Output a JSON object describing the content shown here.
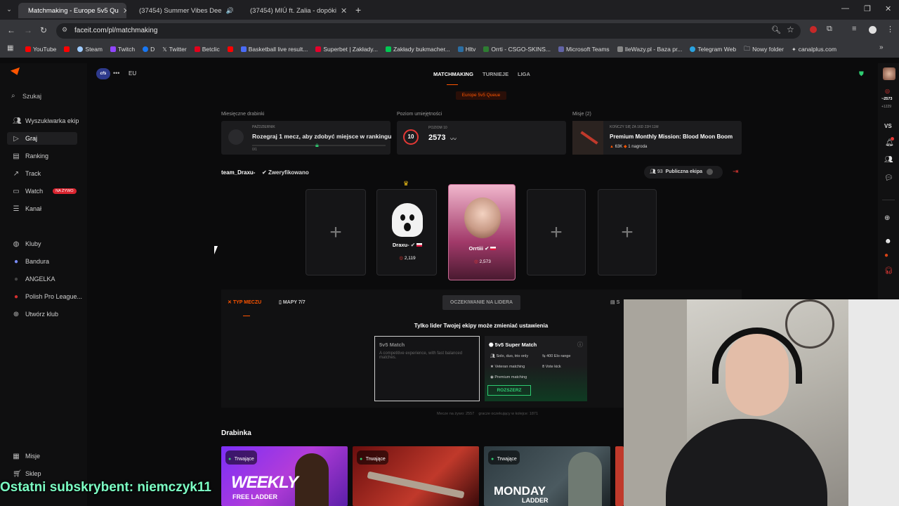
{
  "browser": {
    "tabs": [
      {
        "title": "Matchmaking - Europe 5v5 Qu",
        "favicon_color": "#ff5500",
        "active": true
      },
      {
        "title": "(37454) Summer Vibes Dee",
        "favicon_color": "#ff0000",
        "active": false
      },
      {
        "title": "(37454) MIÚ ft. Zalia - dopóki",
        "favicon_color": "#ff0000",
        "active": false
      }
    ],
    "new_tab": "+",
    "url": "faceit.com/pl/matchmaking",
    "bookmarks": [
      {
        "label": "YouTube",
        "color": "#ff0000"
      },
      {
        "label": "",
        "color": "#ff0000"
      },
      {
        "label": "Steam",
        "color": "#9ecbff"
      },
      {
        "label": "Twitch",
        "color": "#9146ff"
      },
      {
        "label": "D",
        "color": "#1877f2"
      },
      {
        "label": "Twitter",
        "color": "#ffffff"
      },
      {
        "label": "Betclic",
        "color": "#e3001b"
      },
      {
        "label": "",
        "color": "#ff0000"
      },
      {
        "label": "Basketball live result...",
        "color": "#4a6cf7"
      },
      {
        "label": "Superbet | Zakłady...",
        "color": "#e4002b"
      },
      {
        "label": "Zakłady bukmacher...",
        "color": "#00c853"
      },
      {
        "label": "Hltv",
        "color": "#2b6ea3"
      },
      {
        "label": "Orrti - CSGO-SKINS...",
        "color": "#2e7d32"
      },
      {
        "label": "Microsoft Teams",
        "color": "#6264a7"
      },
      {
        "label": "IleWazy.pl - Baza pr...",
        "color": "#888888"
      },
      {
        "label": "Telegram Web",
        "color": "#2aa3e0"
      },
      {
        "label": "Nowy folder",
        "color": "#cccccc"
      },
      {
        "label": "canalplus.com",
        "color": "#ffffff"
      }
    ]
  },
  "sidebar": {
    "search": "Szukaj",
    "items": [
      {
        "label": "Wyszukiwarka ekip",
        "icon": "users-icon"
      },
      {
        "label": "Graj",
        "icon": "play-icon"
      },
      {
        "label": "Ranking",
        "icon": "ranking-icon"
      },
      {
        "label": "Track",
        "icon": "track-icon"
      },
      {
        "label": "Watch",
        "icon": "watch-icon"
      },
      {
        "label": "Kanał",
        "icon": "feed-icon"
      }
    ],
    "watch_badge": "NA ŻYWO",
    "clubs": [
      {
        "label": "Kluby"
      },
      {
        "label": "Bandura"
      },
      {
        "label": "ANGELKA"
      },
      {
        "label": "Polish Pro League..."
      },
      {
        "label": "Utwórz klub"
      }
    ],
    "bottom": [
      "Misje",
      "Sklep"
    ]
  },
  "topnav": {
    "region": "EU",
    "links": [
      "MATCHMAKING",
      "TURNIEJE",
      "LIGA"
    ],
    "queue_badge": "Europe 5v5 Queue"
  },
  "stats": {
    "ladder_heading": "Miesięczne drabinki",
    "ladder_month": "PAŹDZIERNIK",
    "ladder_text": "Rozegraj 1 mecz, aby zdobyć miejsce w rankingu",
    "ladder_progress_text": "0/1",
    "skill_heading": "Poziom umiejętności",
    "skill_level_label": "POZIOM 10",
    "skill_level": "10",
    "elo": "2573",
    "missions_heading": "Misje (2)",
    "mission_time": "KOŃCZY SIĘ ZA 16D 23H 11M",
    "mission_title": "Premium Monthly Mission: Blood Moon Boom",
    "mission_xp": "63K",
    "mission_reward": "1 nagroda"
  },
  "party": {
    "name": "team_Draxu-",
    "verified": "Zweryfikowano",
    "count": "93",
    "visibility": "Publiczna ekipa",
    "members": [
      {
        "name": "Draxu-",
        "elo": "2,119",
        "leader": true
      },
      {
        "name": "Orrtiii",
        "elo": "2,573",
        "leader": false
      }
    ]
  },
  "settings": {
    "tab_type": "TYP MECZU",
    "tab_maps": "MAPY 7/7",
    "waiting": "OCZEKIWANIE NA LIDERA",
    "more": "S",
    "leader_only": "Tylko lider Twojej ekipy może zmieniać ustawienia",
    "match_title": "5v5 Match",
    "match_desc": "A competitive experience, with fast balanced matches.",
    "super_title": "5v5 Super Match",
    "features": [
      "Solo, duo, trio only",
      "400 Elo range",
      "Veteran matching",
      "Vote kick",
      "Premium matching"
    ],
    "expand_button": "ROZSZERZ",
    "queue_in": "Mecze na żywo: 2557",
    "queue_count": "gracze oczekujący w kolejce: 1871"
  },
  "ladders": {
    "title": "Drabinka",
    "cards": [
      {
        "status": "Trwające",
        "title": "WEEKLY",
        "subtitle": "FREE LADDER"
      },
      {
        "status": "Trwające",
        "title": "",
        "subtitle": ""
      },
      {
        "status": "Trwające",
        "title": "MONDAY",
        "subtitle": "LADDER"
      }
    ]
  },
  "rightbar": {
    "elo": "~2573",
    "delta": "+1229",
    "vs": "VS"
  },
  "overlay": {
    "subscriber": "Ostatni subskrybent: niemczyk11"
  },
  "colors": {
    "accent": "#ff5500",
    "live": "#2ecc71",
    "badge": "#d9242f"
  }
}
